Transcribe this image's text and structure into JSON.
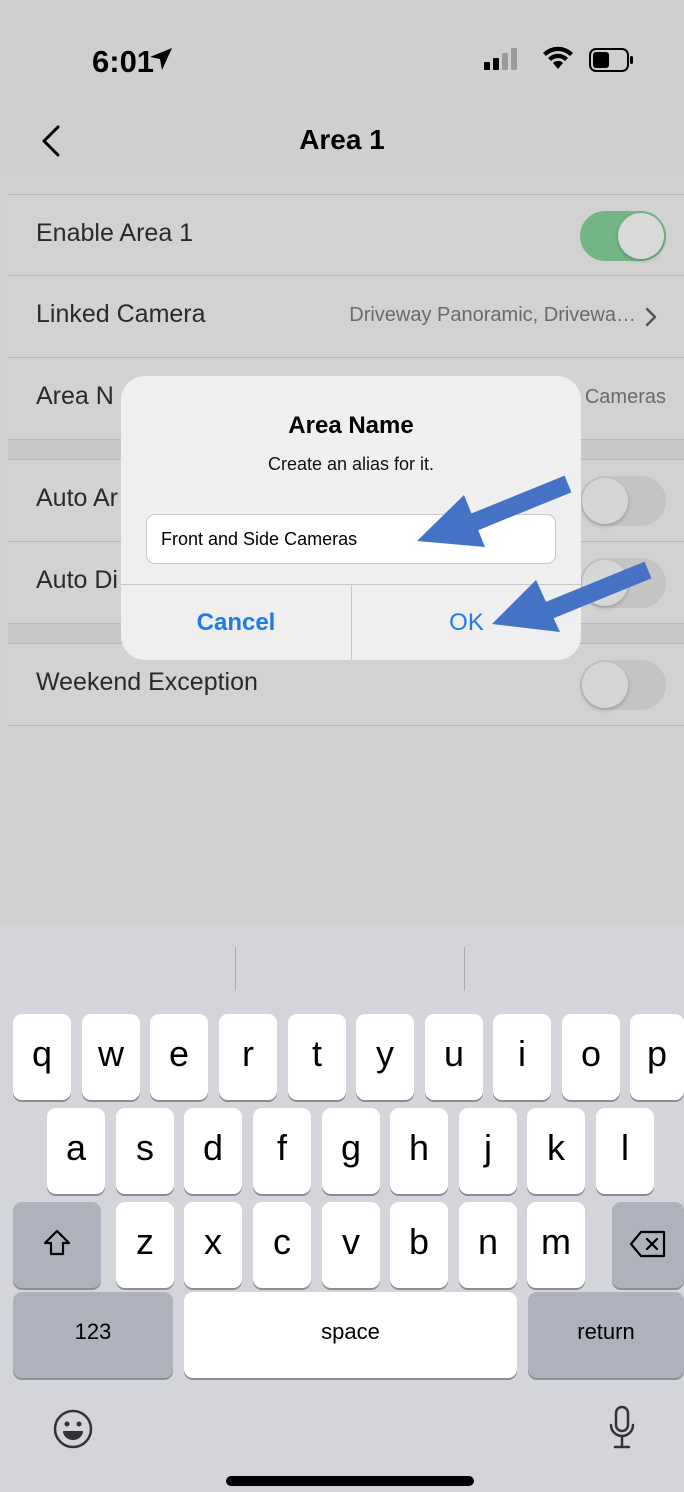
{
  "status_bar": {
    "time": "6:01"
  },
  "nav": {
    "title": "Area 1"
  },
  "settings": {
    "enable_label": "Enable Area 1",
    "linked_label": "Linked Camera",
    "linked_value": "Driveway Panoramic, Drivewa…",
    "area_name_label": "Area N",
    "area_name_value": "Cameras",
    "auto_arm_label": "Auto Ar",
    "auto_disarm_label": "Auto Di",
    "weekend_label": "Weekend Exception"
  },
  "dialog": {
    "title": "Area Name",
    "message": "Create an alias for it.",
    "input_value": "Front and Side Cameras",
    "cancel_label": "Cancel",
    "ok_label": "OK"
  },
  "keyboard": {
    "row1": [
      "q",
      "w",
      "e",
      "r",
      "t",
      "y",
      "u",
      "i",
      "o",
      "p"
    ],
    "row2": [
      "a",
      "s",
      "d",
      "f",
      "g",
      "h",
      "j",
      "k",
      "l"
    ],
    "row3": [
      "z",
      "x",
      "c",
      "v",
      "b",
      "n",
      "m"
    ],
    "numbers_label": "123",
    "space_label": "space",
    "return_label": "return"
  },
  "colors": {
    "accent": "#1f7be6",
    "toggle_on": "#73b585",
    "arrow": "#4472c4"
  }
}
